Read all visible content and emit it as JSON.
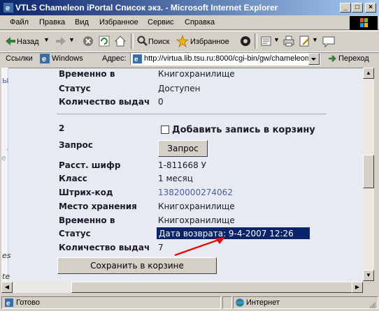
{
  "window": {
    "title": "VTLS Chameleon iPortal Список экз. - Microsoft Internet Explorer",
    "minimize": "_",
    "maximize": "□",
    "close": "×"
  },
  "menu": [
    "Файл",
    "Правка",
    "Вид",
    "Избранное",
    "Сервис",
    "Справка"
  ],
  "toolbar": {
    "back": "Назад",
    "search": "Поиск",
    "favorites": "Избранное"
  },
  "addressbar": {
    "links": "Ссылки",
    "windows": "Windows",
    "address_label": "Адрес:",
    "url": "http://virtua.lib.tsu.ru:8000/cgi-bin/gw/chameleon",
    "go": "Переход"
  },
  "left_fragments": [
    "ы",
    "е",
    "*",
    "es",
    "te"
  ],
  "record_top": {
    "rows": [
      {
        "label": "Временно в",
        "value": "Книгохранилище"
      },
      {
        "label": "Статус",
        "value": "Доступен"
      },
      {
        "label": "Количество выдач",
        "value": "0"
      }
    ]
  },
  "record2": {
    "number": "2",
    "basket_checkbox_label": "Добавить запись в корзину",
    "request_label": "Запрос",
    "request_button": "Запрос",
    "rows": [
      {
        "label": "Расст. шифр",
        "value": "1-811668 У"
      },
      {
        "label": "Класс",
        "value": "1 месяц"
      },
      {
        "label": "Штрих-код",
        "value": "13820000274062"
      },
      {
        "label": "Место хранения",
        "value": "Книгохранилище"
      },
      {
        "label": "Временно в",
        "value": "Книгохранилище"
      },
      {
        "label": "Статус",
        "value": "Дата возврата: 9-4-2007 12:26"
      },
      {
        "label": "Количество выдач",
        "value": "7"
      }
    ]
  },
  "save_button": "Сохранить в корзине",
  "status": {
    "text": "Готово",
    "zone": "Интернет"
  },
  "colors": {
    "titlebar_start": "#0a246a",
    "highlight": "#0a246a",
    "arrow": "#e01010",
    "link": "#4b5ea0"
  }
}
